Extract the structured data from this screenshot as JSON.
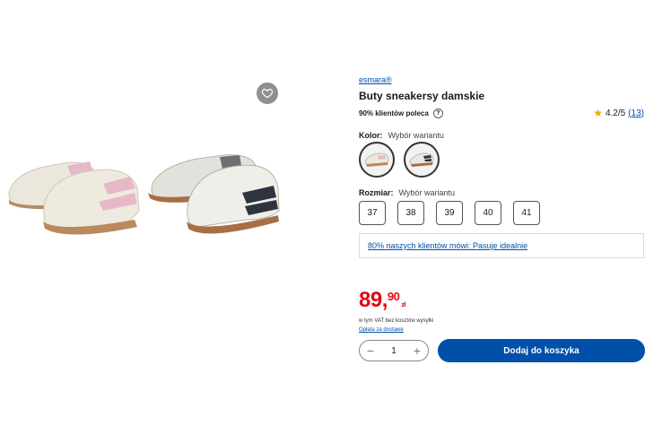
{
  "product": {
    "brand": "esmara®",
    "title": "Buty sneakersy damskie",
    "recommendation": "90% klientów poleca",
    "rating": "4.2/5",
    "rating_count": "(13)"
  },
  "variants": {
    "color_label": "Kolor:",
    "color_value": "Wybór wariantu",
    "size_label": "Rozmiar:",
    "size_value": "Wybór wariantu",
    "sizes": [
      "37",
      "38",
      "39",
      "40",
      "41"
    ],
    "fit_note": "80% naszych klientów mówi: Pasuje idealnie"
  },
  "pricing": {
    "price_int": "89,",
    "price_dec": "90",
    "currency": "zł",
    "vat_note": "w tym VAT bez kosztów wysyłki",
    "shipping_link": "Opłata za dostawę"
  },
  "cart": {
    "quantity": "1",
    "minus": "−",
    "plus": "+",
    "add_label": "Dodaj do koszyka"
  },
  "colors": {
    "accent": "#0050aa",
    "price": "#e10915"
  }
}
